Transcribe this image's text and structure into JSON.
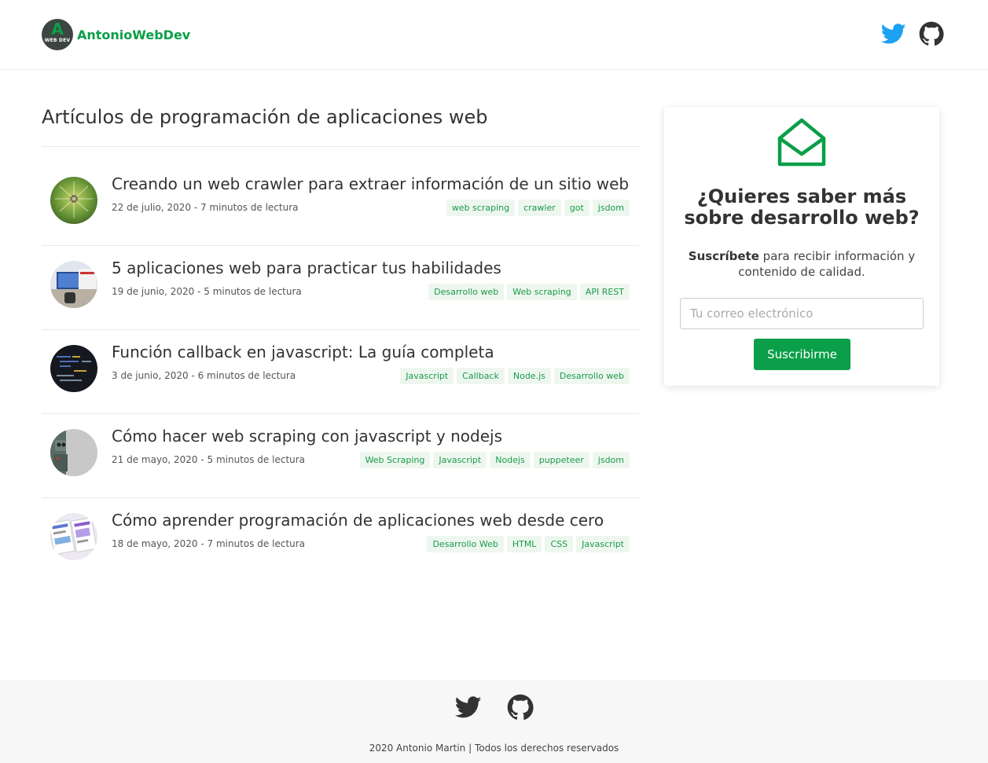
{
  "site": {
    "brand": "AntonioWebDev",
    "logo_letter": "A",
    "logo_subtext": "WEB DEV"
  },
  "colors": {
    "accent": "#0a9f48",
    "twitter": "#1da1f2",
    "github": "#333333",
    "tag_bg": "#eef7ef"
  },
  "header": {
    "icons": [
      "twitter-icon",
      "github-icon"
    ]
  },
  "main": {
    "title": "Artículos de programación de aplicaciones web",
    "articles": [
      {
        "title": "Creando un web crawler para extraer información de un sitio web",
        "meta": "22 de julio, 2020 - 7 minutos de lectura",
        "tags": [
          "web scraping",
          "crawler",
          "got",
          "jsdom"
        ]
      },
      {
        "title": "5 aplicaciones web para practicar tus habilidades",
        "meta": "19 de junio, 2020 - 5 minutos de lectura",
        "tags": [
          "Desarrollo web",
          "Web scraping",
          "API REST"
        ]
      },
      {
        "title": "Función callback en javascript: La guía completa",
        "meta": "3 de junio, 2020 - 6 minutos de lectura",
        "tags": [
          "Javascript",
          "Callback",
          "Node.js",
          "Desarrollo web"
        ]
      },
      {
        "title": "Cómo hacer web scraping con javascript y nodejs",
        "meta": "21 de mayo, 2020 - 5 minutos de lectura",
        "tags": [
          "Web Scraping",
          "Javascript",
          "Nodejs",
          "puppeteer",
          "jsdom"
        ]
      },
      {
        "title": "Cómo aprender programación de aplicaciones web desde cero",
        "meta": "18 de mayo, 2020 - 7 minutos de lectura",
        "tags": [
          "Desarrollo Web",
          "HTML",
          "CSS",
          "Javascript"
        ]
      }
    ]
  },
  "sidebar": {
    "icon": "envelope-open-icon",
    "title": "¿Quieres saber más sobre desarrollo web?",
    "text_bold": "Suscríbete",
    "text_rest": " para recibir información y contenido de calidad.",
    "email_placeholder": "Tu correo electrónico",
    "button_label": "Suscribirme"
  },
  "footer": {
    "copyright": "2020 Antonio Martin | Todos los derechos reservados"
  }
}
